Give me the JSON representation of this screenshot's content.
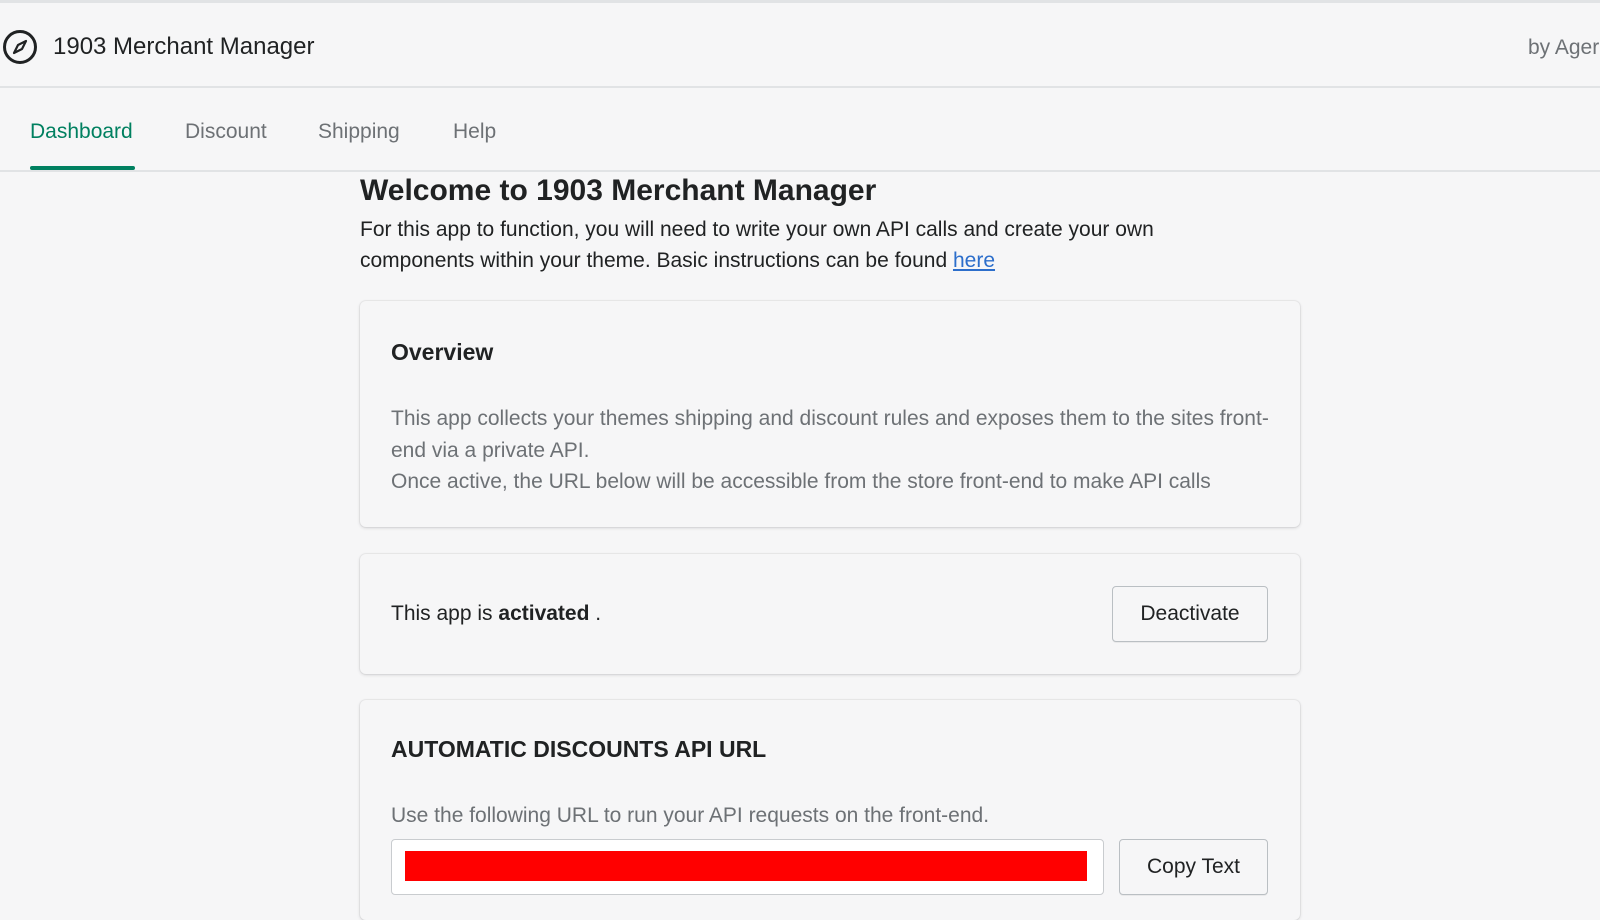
{
  "header": {
    "app_title": "1903 Merchant Manager",
    "by_text": "by Ager",
    "app_icon": "compass-icon"
  },
  "tabs": [
    {
      "label": "Dashboard",
      "active": true
    },
    {
      "label": "Discount",
      "active": false
    },
    {
      "label": "Shipping",
      "active": false
    },
    {
      "label": "Help",
      "active": false
    }
  ],
  "welcome": {
    "title": "Welcome to 1903 Merchant Manager",
    "text_before_link": "For this app to function, you will need to write your own API calls and create your own components within your theme. Basic instructions can be found ",
    "link_label": "here"
  },
  "overview": {
    "heading": "Overview",
    "line1": "This app collects your themes shipping and discount rules and exposes them to the sites front-end via a private API.",
    "line2": "Once active, the URL below will be accessible from the store front-end to make API calls"
  },
  "status": {
    "prefix": "This app is ",
    "state": "activated",
    "suffix": " .",
    "button_label": "Deactivate"
  },
  "api_url": {
    "heading": "AUTOMATIC DISCOUNTS API URL",
    "description": "Use the following URL to run your API requests on the front-end.",
    "value": "",
    "redaction_color": "#ff0000",
    "copy_button_label": "Copy Text"
  },
  "colors": {
    "accent": "#008060",
    "link": "#2c6ecb",
    "background": "#f6f6f7"
  }
}
